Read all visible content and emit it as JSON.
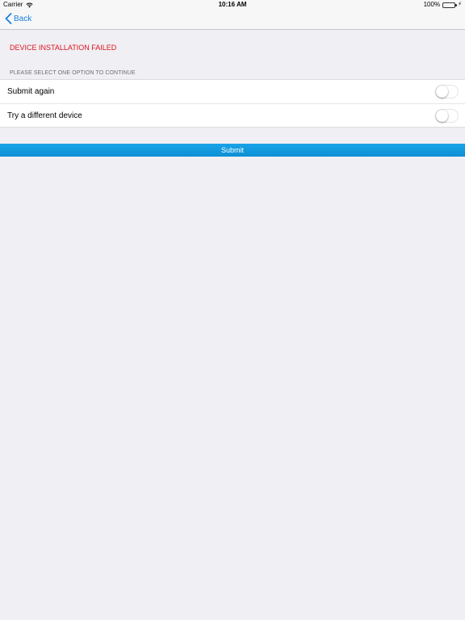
{
  "status_bar": {
    "carrier": "Carrier",
    "time": "10:16 AM",
    "battery_percent": "100%",
    "battery_level": 1.0,
    "icons": [
      "wifi-icon",
      "battery-icon",
      "charging-bolt-icon"
    ]
  },
  "nav": {
    "back_label": "Back",
    "back_icon": "chevron-left-icon"
  },
  "error": {
    "title": "DEVICE INSTALLATION FAILED",
    "color": "#e0131b"
  },
  "options_section": {
    "header": "PLEASE SELECT ONE OPTION TO CONTINUE",
    "items": [
      {
        "label": "Submit again",
        "on": false
      },
      {
        "label": "Try a different device",
        "on": false
      }
    ]
  },
  "submit": {
    "label": "Submit",
    "color": "#0d8fd4"
  },
  "colors": {
    "accent": "#1a7fe0",
    "background": "#efeff4"
  }
}
